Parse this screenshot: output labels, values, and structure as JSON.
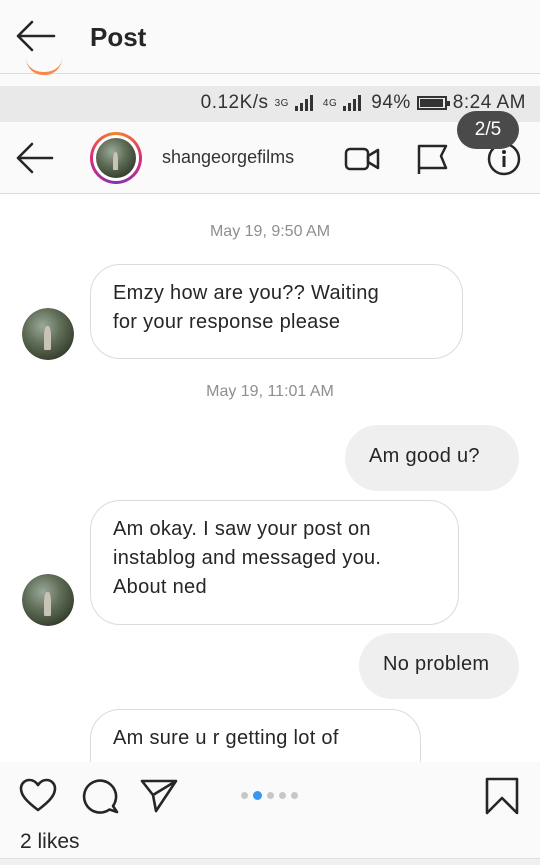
{
  "post_header": {
    "title": "Post"
  },
  "statusbar": {
    "speed": "0.12K/s",
    "net1": "3G",
    "net2": "4G",
    "battery": "94%",
    "battery_level": 0.94,
    "time": "8:24 AM"
  },
  "carousel": {
    "badge": "2/5",
    "total": 5,
    "active": 2
  },
  "dm": {
    "username": "shangeorgefilms",
    "icons": [
      "back-arrow-icon",
      "video-call-icon",
      "flag-icon",
      "info-icon"
    ]
  },
  "messages": {
    "ts1": "May 19, 9:50 AM",
    "m1": [
      "Emzy how are you?? Waiting",
      "for your response please"
    ],
    "ts2": "May 19, 11:01 AM",
    "m2": "Am good u?",
    "m3": [
      "Am okay. I saw your post on",
      "instablog and messaged you.",
      "About ned"
    ],
    "m4": "No problem",
    "m5": "Am sure u r getting lot of"
  },
  "actions": {
    "icons": [
      "heart-icon",
      "comment-icon",
      "share-icon",
      "bookmark-icon"
    ]
  },
  "likes": "2 likes"
}
